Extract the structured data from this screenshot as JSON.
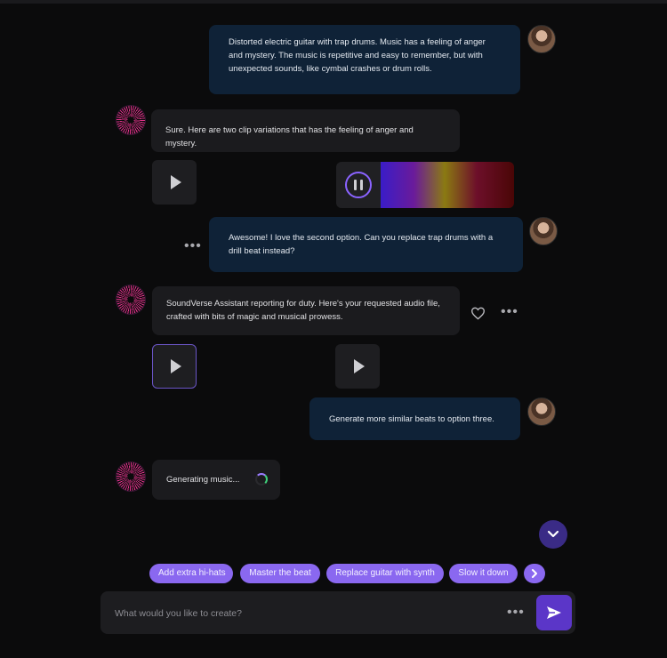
{
  "messages": {
    "user_1": "Distorted electric guitar with trap drums. Music has a feeling of anger and mystery. The music is repetitive and easy to remember, but with unexpected sounds, like cymbal crashes or drum rolls.",
    "bot_1": "Sure. Here are two clip variations that has the feeling of anger and mystery.",
    "user_2": "Awesome! I love the second option. Can you replace trap drums with a drill beat instead?",
    "bot_2": "SoundVerse Assistant reporting for duty. Here's your requested audio file, crafted with bits of magic and musical prowess.",
    "user_3": "Generate more similar beats to option three.",
    "bot_3": "Generating music..."
  },
  "suggestions": [
    "Add extra hi-hats",
    "Master the beat",
    "Replace guitar with synth",
    "Slow it down"
  ],
  "composer": {
    "placeholder": "What would you like to create?",
    "more_label": "•••"
  },
  "more_label": "•••",
  "colors": {
    "accent": "#8a68f0",
    "send": "#5b36c8",
    "user_bubble": "#0f2237",
    "bot_bubble": "#1b1b1e"
  },
  "icons": [
    "play-icon",
    "pause-icon",
    "heart-icon",
    "chevron-down-icon",
    "chevron-right-icon",
    "send-icon",
    "more-icon"
  ]
}
